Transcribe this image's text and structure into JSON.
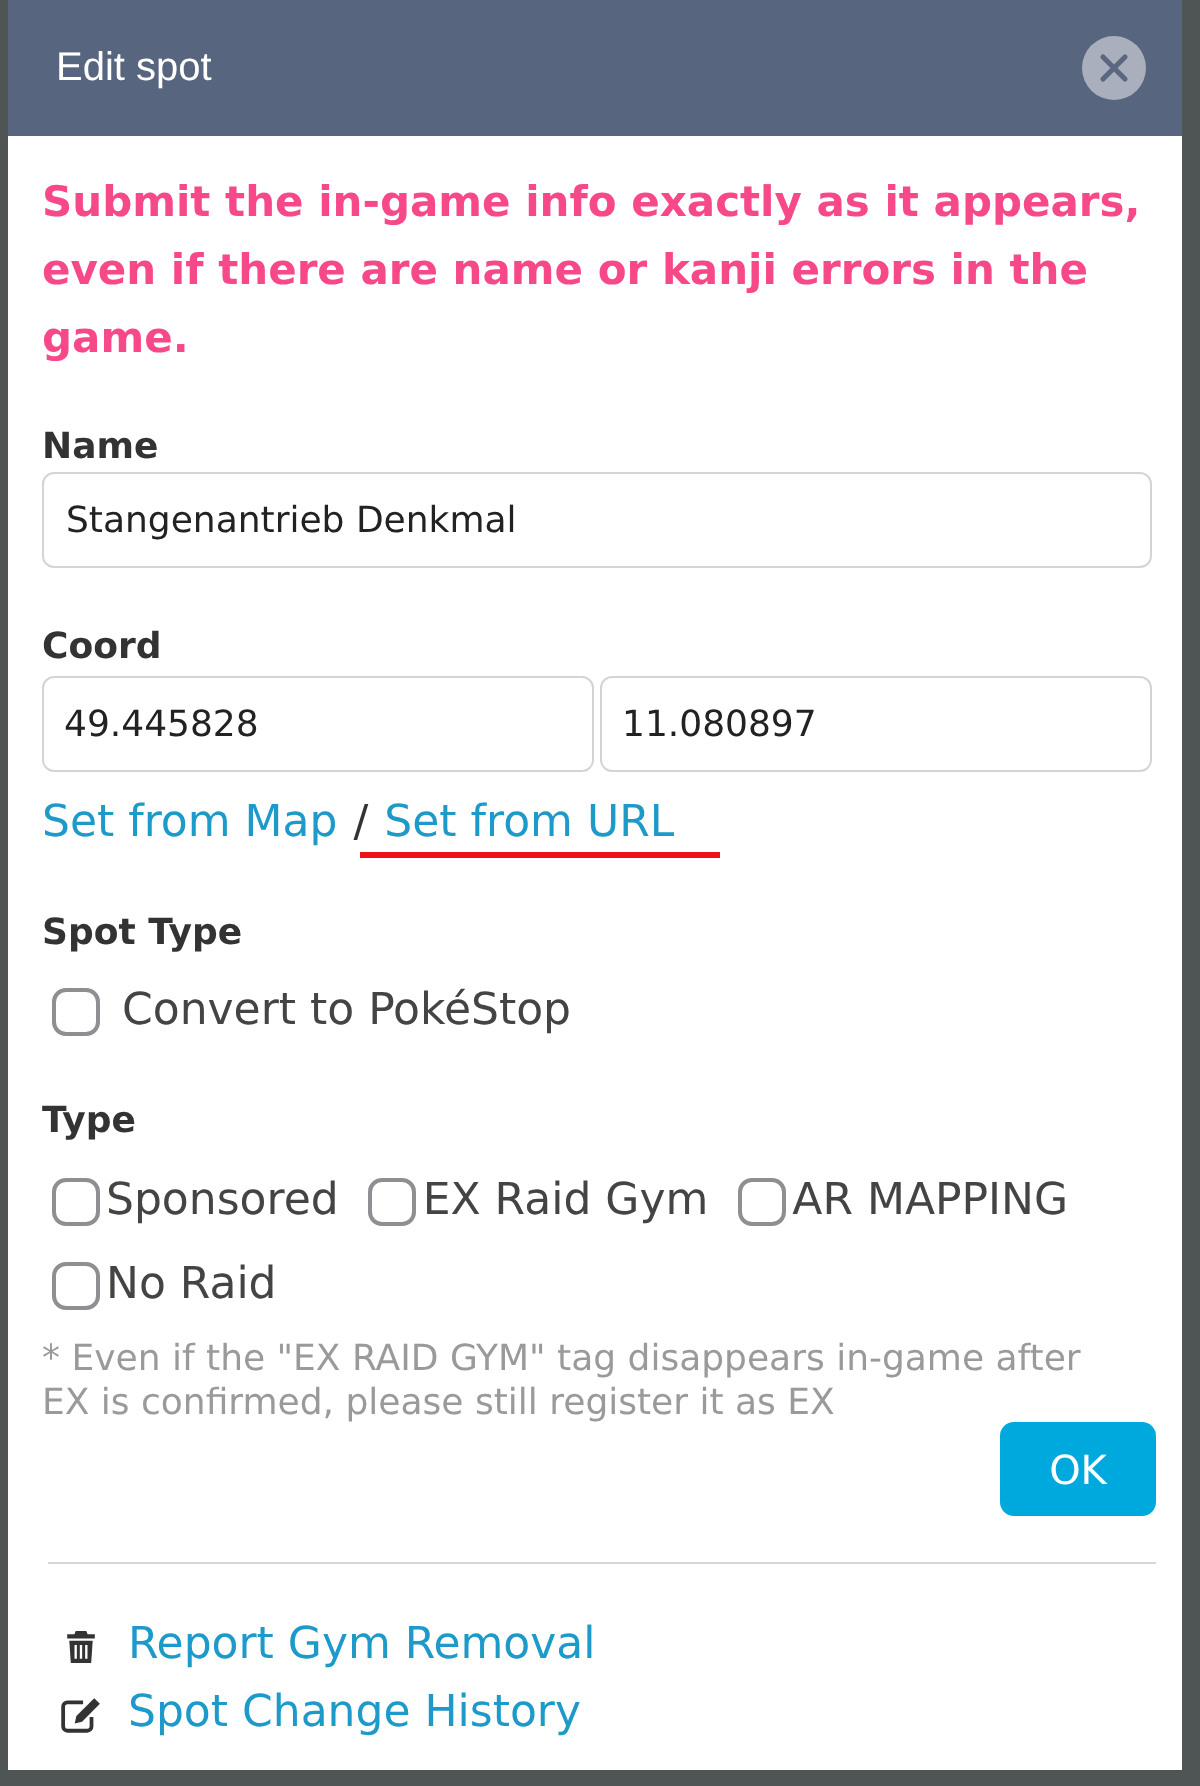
{
  "dialog": {
    "title": "Edit spot"
  },
  "notice": "Submit the in-game info exactly as it appears, even if there are name or kanji errors in the game.",
  "name_field": {
    "label": "Name",
    "value": "Stangenantrieb Denkmal"
  },
  "coord_field": {
    "label": "Coord",
    "values": [
      "49.445828",
      "11.080897"
    ]
  },
  "coord_links": [
    {
      "label": "Set from Map",
      "marked": false
    },
    {
      "label": "Set from URL",
      "marked": true
    }
  ],
  "coord_link_separator": "/",
  "spot_type": {
    "label": "Spot Type",
    "options": [
      {
        "label": "Convert to PokéStop",
        "checked": false
      }
    ]
  },
  "type": {
    "label": "Type",
    "options": [
      {
        "label": "Sponsored",
        "checked": false
      },
      {
        "label": "EX Raid Gym",
        "checked": false
      },
      {
        "label": "AR MAPPING",
        "checked": false
      },
      {
        "label": "No Raid",
        "checked": false
      }
    ]
  },
  "note": "* Even if the \"EX RAID GYM\" tag disappears in-game after EX is confirmed, please still register it as EX",
  "ok_button": {
    "label": "OK"
  },
  "actions": [
    {
      "kind": "trash",
      "label": "Report Gym Removal"
    },
    {
      "kind": "edit",
      "label": "Spot Change History"
    }
  ]
}
